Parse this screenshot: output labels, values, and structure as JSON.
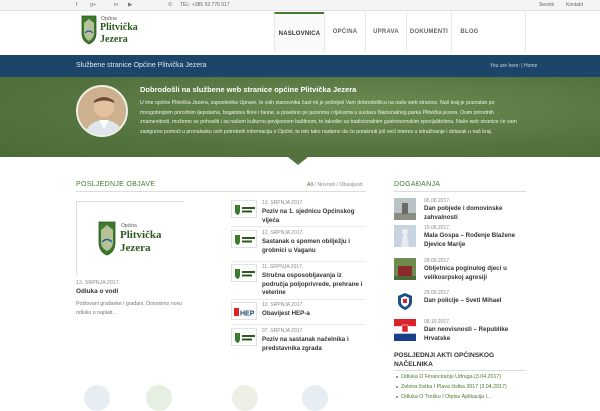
{
  "topbar": {
    "social_icons": [
      "facebook-icon",
      "google-plus-icon",
      "linkedin-icon",
      "youtube-icon",
      "phone-icon"
    ],
    "phone": "TEL: +385 53 776 017",
    "links": [
      "Sesnik",
      "Kontakt"
    ]
  },
  "logo": {
    "small": "Općina",
    "line1": "Plitvička",
    "line2": "Jezera"
  },
  "nav": {
    "items": [
      "NASLOVNICA",
      "OPĆINA",
      "UPRAVA",
      "DOKUMENTI",
      "BLOG"
    ],
    "active": "NASLOVNICA"
  },
  "bluebar": {
    "title": "Službene stranice Općine Plitvička Jezera",
    "crumb_prefix": "You are here:",
    "crumb_current": "Home"
  },
  "hero": {
    "title": "Dobrodošli na službene web stranice općine Plitvička Jezera",
    "text": "U ime općine Plitvička Jezera, zaposlenika Uprave, te svih stanovnika čast mi je poželjeti Vam dobrodošlicu na naše web stranice. Naš kraj je poznatan po mnogobrojnim prirodnim ljepotama, bogatstvu flore i faune, a posebno po jezerima i rijekama u sustavu Nacionalnog parka Plitvička jezera. Osim prirodnih znamenitosti, možemo se pohvaliti i sa našom kulturno-povijesnom baštinom, te također sa tradicionalnim gastronomskim specijalitetima. Naše web stranice će vam zasigurno pomoći u pronalasku svih potrebnih informacija o Općini, te isto tako nadamo da će potaknuti još veći interes u istraživanje i dolazak u naš kraj."
  },
  "posts_section": {
    "heading": "POSLJEDNJE OBJAVE",
    "filters": [
      "All",
      "Novosti",
      "Obavijesti"
    ],
    "featured": {
      "date": "13. SRPNJA 2017.",
      "title": "Odluka o vodi",
      "excerpt": "Poštovani građanke i građani, Donosimo novu odluku o naplati..."
    },
    "list": [
      {
        "date": "13. SRPNJA 2017.",
        "title": "Poziv na 1. sjednicu Općinskog vijeća",
        "icon": "municipality-logo-icon"
      },
      {
        "date": "12. SRPNJA 2017.",
        "title": "Sastanak o spomen obilježju i grobnici u Vaganu",
        "icon": "municipality-logo-icon"
      },
      {
        "date": "11. SRPNJA 2017.",
        "title": "Stručna osposobljavanja iz područja poljoprivrede, prehrane i veterine",
        "icon": "municipality-logo-icon"
      },
      {
        "date": "10. SRPNJA 2017.",
        "title": "Obavijest HEP-a",
        "icon": "hep-logo-icon"
      },
      {
        "date": "07. SRPNJA 2017.",
        "title": "Poziv na sastanak načelnika i predstavnika zgrada",
        "icon": "municipality-logo-icon"
      }
    ]
  },
  "events_section": {
    "heading": "DOGAĐANJA",
    "events": [
      {
        "date": "05.08.2017.",
        "title": "Dan pobjede i domovinske zahvalnosti",
        "thumb": "monument-photo-icon"
      },
      {
        "date": "15.08.2017.",
        "title": "Mala Gospa – Rođenje Blažene Djevice Marije",
        "thumb": "statue-photo-icon"
      },
      {
        "date": "28.09.2017.",
        "title": "Obljetnica poginulog djeci u velikosrpskoj agresiji",
        "thumb": "memorial-photo-icon"
      },
      {
        "date": "29.09.2017.",
        "title": "Dan policije – Sveti Mihael",
        "thumb": "police-badge-icon"
      },
      {
        "date": "08.10.2017.",
        "title": "Dan neovisnosti – Republike Hrvatske",
        "thumb": "croatia-flag-icon"
      }
    ]
  },
  "acts_section": {
    "heading": "POSLJEDNJI AKTI OPĆINSKOG NAČELNIKA",
    "items": [
      "Odluka O Financiranju Udruga (3.04.2017)",
      "Zelena čistka I Plava čistka 2017 (3.04.2017)",
      "Odluka O Trošku I Otpisu Aplikacija I..."
    ]
  },
  "colors": {
    "accent_green": "#4a7a2e",
    "blue_bar": "#1b4569",
    "hero_green": "#5c7a45"
  }
}
